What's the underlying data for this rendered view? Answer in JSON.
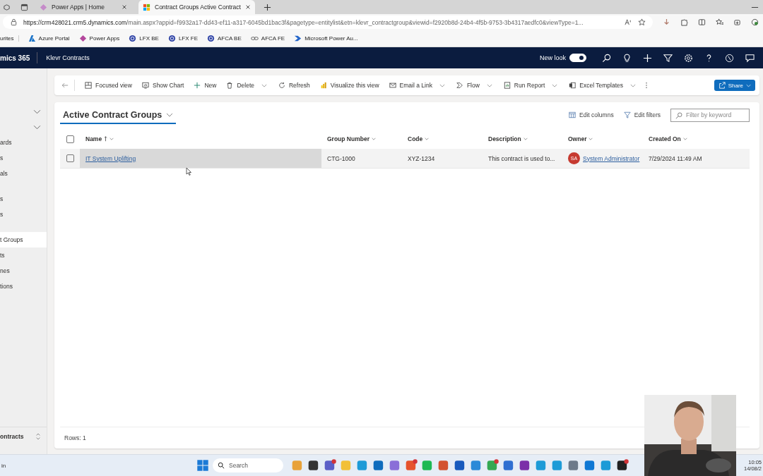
{
  "browser": {
    "tabs": [
      {
        "title": "Power Apps | Home",
        "selected": false,
        "kind": "powerapps"
      },
      {
        "title": "Contract Groups Active Contract",
        "selected": true,
        "kind": "microsoft"
      }
    ],
    "url_host": "https://crm428021.crm5.dynamics.com",
    "url_path": "/main.aspx?appid=f9932a17-dd43-ef11-a317-6045bd1bac3f&pagetype=entitylist&etn=klevr_contractgroup&viewid=f2920b8d-24b4-4f5b-9753-3b4317aedfc0&viewType=1...",
    "favorites_label": "urites",
    "favorites": [
      {
        "label": "Azure Portal",
        "kind": "azure"
      },
      {
        "label": "Power Apps",
        "kind": "powerapps"
      },
      {
        "label": "LFX BE",
        "kind": "circle"
      },
      {
        "label": "LFX FE",
        "kind": "circle"
      },
      {
        "label": "AFCA BE",
        "kind": "circle"
      },
      {
        "label": "AFCA FE",
        "kind": "link"
      },
      {
        "label": "Microsoft Power Au...",
        "kind": "automate"
      }
    ]
  },
  "app": {
    "title": "mics 365",
    "area": "Klevr Contracts",
    "new_look": {
      "label": "New look",
      "on": true
    }
  },
  "sidebar": {
    "items": [
      {
        "kind": "group",
        "expanded": true
      },
      {
        "kind": "group",
        "expanded": true
      },
      {
        "kind": "item",
        "label": "ards",
        "selected": false
      },
      {
        "kind": "item",
        "label": "s",
        "selected": false
      },
      {
        "kind": "item",
        "label": "als",
        "selected": false
      },
      {
        "kind": "gap"
      },
      {
        "kind": "item",
        "label": "s",
        "selected": false
      },
      {
        "kind": "item",
        "label": "s",
        "selected": false
      },
      {
        "kind": "gap"
      },
      {
        "kind": "item",
        "label": "t Groups",
        "selected": true
      },
      {
        "kind": "item",
        "label": "ts",
        "selected": false
      },
      {
        "kind": "item",
        "label": "nes",
        "selected": false
      },
      {
        "kind": "item",
        "label": "tions",
        "selected": false
      }
    ],
    "area_switcher": "ontracts"
  },
  "command_bar": [
    {
      "label": "Focused view",
      "kind": "focused"
    },
    {
      "label": "Show Chart",
      "kind": "chart"
    },
    {
      "label": "New",
      "kind": "new"
    },
    {
      "label": "Delete",
      "kind": "delete",
      "split": true
    },
    {
      "label": "Refresh",
      "kind": "refresh"
    },
    {
      "label": "Visualize this view",
      "kind": "visualize"
    },
    {
      "label": "Email a Link",
      "kind": "email",
      "split": true
    },
    {
      "label": "Flow",
      "kind": "flow",
      "split": true
    },
    {
      "label": "Run Report",
      "kind": "report",
      "split": true
    },
    {
      "label": "Excel Templates",
      "kind": "excel",
      "split": true
    }
  ],
  "share": "Share",
  "view": {
    "title": "Active Contract Groups",
    "all_selected": false,
    "edit_columns": "Edit columns",
    "edit_filters": "Edit filters",
    "filter_placeholder": "Filter by keyword",
    "columns": [
      {
        "label": "Name",
        "sorted": true
      },
      {
        "label": "Group Number",
        "sorted": false
      },
      {
        "label": "Code",
        "sorted": false
      },
      {
        "label": "Description",
        "sorted": false
      },
      {
        "label": "Owner",
        "sorted": false
      },
      {
        "label": "Created On",
        "sorted": false
      }
    ],
    "rows": [
      {
        "selected": false,
        "hovered": true,
        "name": "IT System Uplifting",
        "group_number": "CTG-1000",
        "code": "XYZ-1234",
        "description": "This contract is used to...",
        "owner_initials": "SA",
        "owner": "System Administrator",
        "created_on": "7/29/2024 11:49 AM"
      }
    ],
    "footer": "Rows: 1"
  },
  "taskbar": {
    "left_text": "in",
    "search_placeholder": "Search",
    "apps": [
      {
        "color": "#e8a23a",
        "badge": false
      },
      {
        "color": "#333333",
        "badge": false
      },
      {
        "color": "#5b5fc7",
        "badge": true
      },
      {
        "color": "#f2c037",
        "badge": false
      },
      {
        "color": "#1d9bd7",
        "badge": false
      },
      {
        "color": "#0f6cbd",
        "badge": false
      },
      {
        "color": "#8a6fd8",
        "badge": false
      },
      {
        "color": "#e6532d",
        "badge": true
      },
      {
        "color": "#1db954",
        "badge": false
      },
      {
        "color": "#d35230",
        "badge": false
      },
      {
        "color": "#185abd",
        "badge": false
      },
      {
        "color": "#2b8ad8",
        "badge": false
      },
      {
        "color": "#34a853",
        "badge": true
      },
      {
        "color": "#2f6fd1",
        "badge": false
      },
      {
        "color": "#7b2fa8",
        "badge": false
      },
      {
        "color": "#1d9bd7",
        "badge": false
      },
      {
        "color": "#1d9bd7",
        "badge": false
      },
      {
        "color": "#6d7a8a",
        "badge": false
      },
      {
        "color": "#0f78d4",
        "badge": false
      },
      {
        "color": "#1d9bd7",
        "badge": false
      },
      {
        "color": "#222222",
        "badge": true
      }
    ],
    "time": "10:05",
    "date": "14/08/2"
  }
}
